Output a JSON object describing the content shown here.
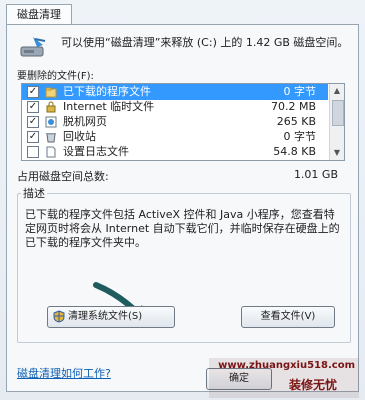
{
  "tab": {
    "label": "磁盘清理"
  },
  "intro": {
    "text": "可以使用“磁盘清理”来释放  (C:) 上的 1.42 GB 磁盘空间。"
  },
  "files_to_delete": {
    "label": "要删除的文件(F):",
    "items": [
      {
        "name": "已下载的程序文件",
        "size": "0 字节",
        "checked": true,
        "selected": true,
        "icon": "folder-icon"
      },
      {
        "name": "Internet 临时文件",
        "size": "70.2 MB",
        "checked": true,
        "selected": false,
        "icon": "lock-icon"
      },
      {
        "name": "脱机网页",
        "size": "265 KB",
        "checked": true,
        "selected": false,
        "icon": "offline-page-icon"
      },
      {
        "name": "回收站",
        "size": "0 字节",
        "checked": true,
        "selected": false,
        "icon": "recycle-bin-icon"
      },
      {
        "name": "设置日志文件",
        "size": "54.8 KB",
        "checked": false,
        "selected": false,
        "icon": "file-icon"
      }
    ]
  },
  "total": {
    "label": "占用磁盘空间总数:",
    "value": "1.01 GB"
  },
  "description": {
    "title": "描述",
    "text": "已下载的程序文件包括 ActiveX 控件和 Java 小程序，您查看特定网页时将会从 Internet 自动下载它们，并临时保存在硬盘上的已下载的程序文件夹中。"
  },
  "buttons": {
    "clean_system": "清理系统文件(S)",
    "view_files": "查看文件(V)",
    "ok": "确定"
  },
  "help_link": "磁盘清理如何工作?",
  "watermark": {
    "url": "www.zhuangxiu518.com",
    "name": "装修无忧"
  },
  "colors": {
    "selection": "#3399ff",
    "link": "#0b5fb5",
    "arrow": "#1f5c5e"
  }
}
